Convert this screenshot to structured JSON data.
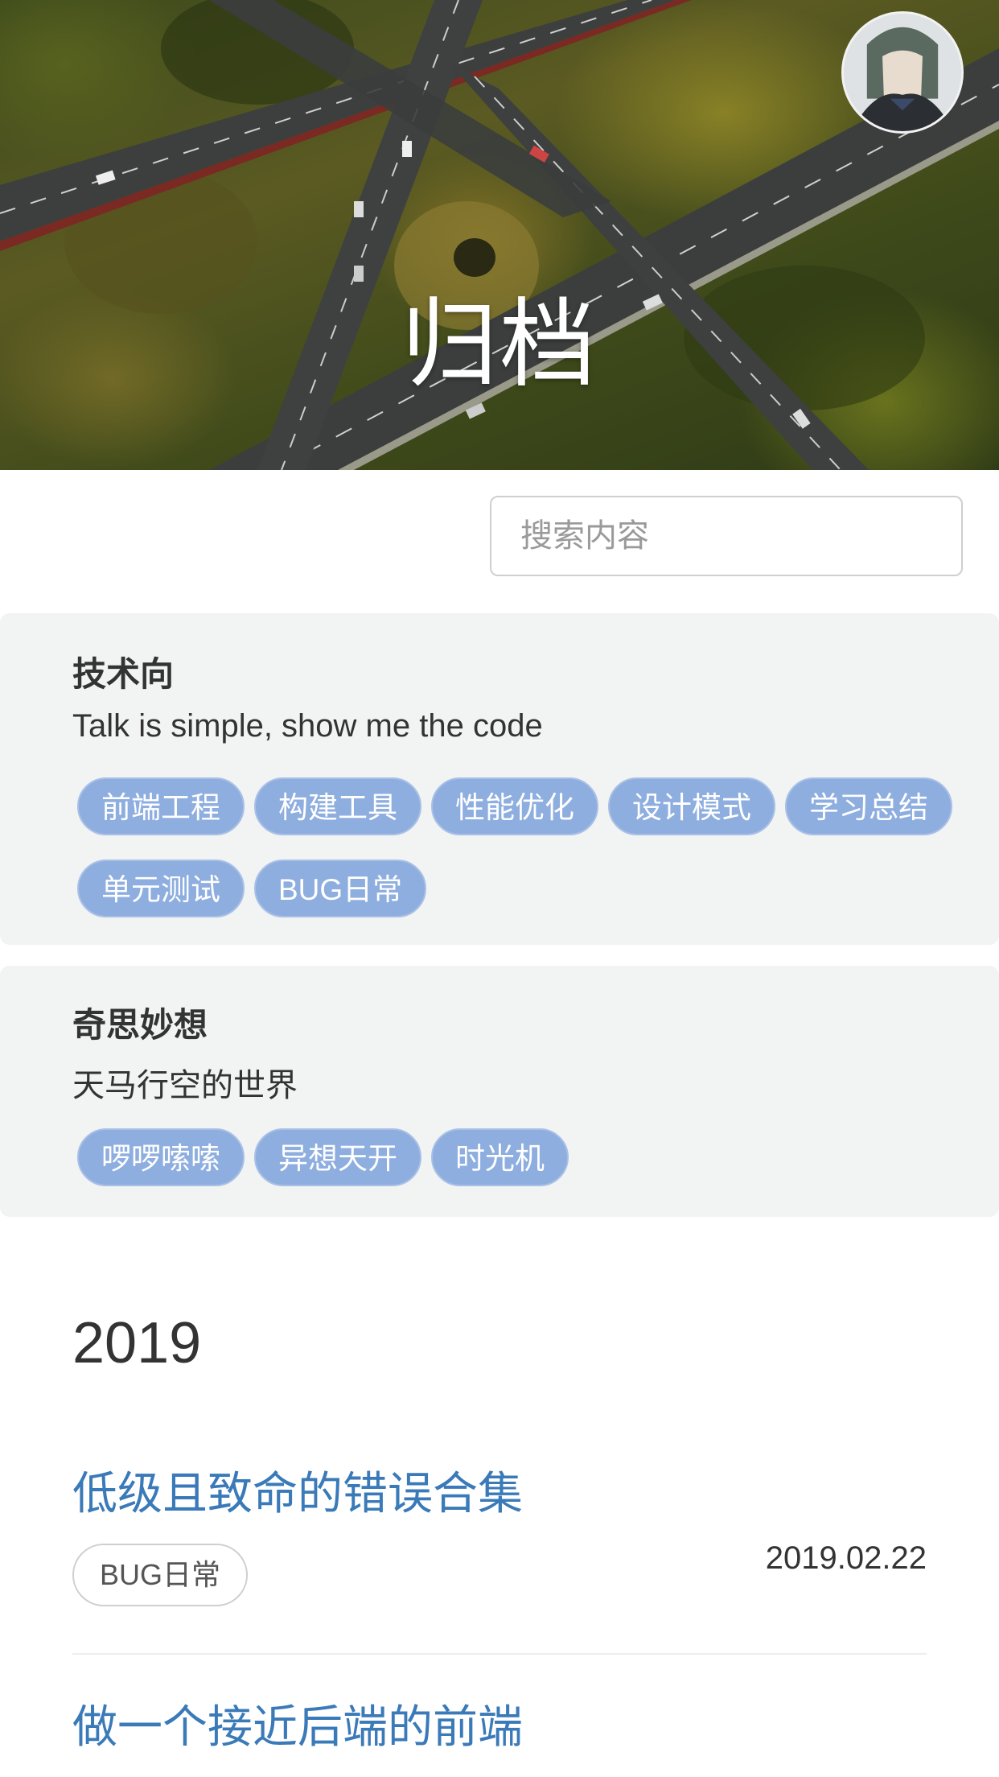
{
  "hero": {
    "title": "归档"
  },
  "search": {
    "placeholder": "搜索内容"
  },
  "categories": [
    {
      "title": "技术向",
      "description": "Talk is simple, show me the code",
      "tags": [
        "前端工程",
        "构建工具",
        "性能优化",
        "设计模式",
        "学习总结",
        "单元测试",
        "BUG日常"
      ]
    },
    {
      "title": "奇思妙想",
      "description": "天马行空的世界",
      "tags": [
        "啰啰嗦嗦",
        "异想天开",
        "时光机"
      ]
    }
  ],
  "archive": {
    "year": "2019",
    "posts": [
      {
        "title": "低级且致命的错误合集",
        "tags": [
          "BUG日常"
        ],
        "date": "2019.02.22"
      },
      {
        "title": "做一个接近后端的前端",
        "tags": [
          "",
          ""
        ],
        "date": ""
      }
    ]
  },
  "colors": {
    "tag_fill": "#8eaedf",
    "card_bg": "#f2f3f3",
    "post_title": "#3a7ab8"
  }
}
